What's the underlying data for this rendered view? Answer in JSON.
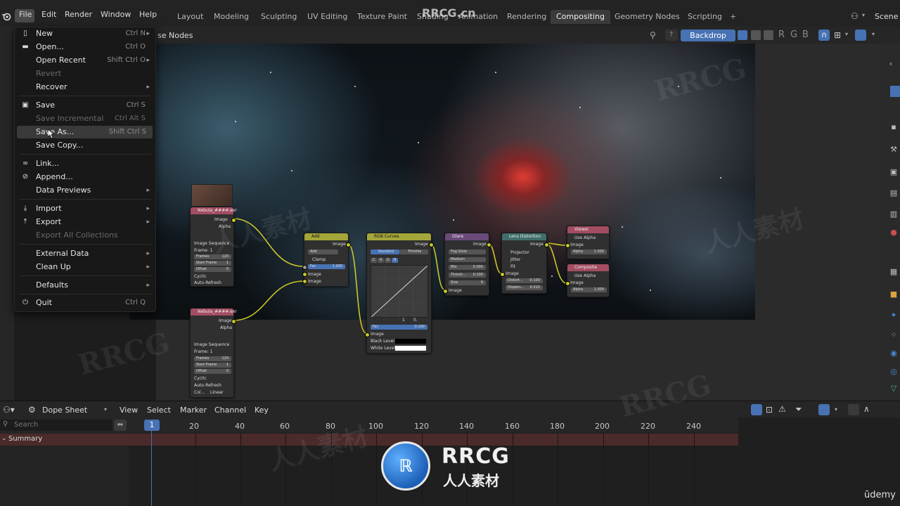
{
  "menubar": [
    "File",
    "Edit",
    "Render",
    "Window",
    "Help"
  ],
  "workspace_tabs": [
    "Layout",
    "Modeling",
    "Sculpting",
    "UV Editing",
    "Texture Paint",
    "Shading",
    "Animation",
    "Rendering",
    "Compositing",
    "Geometry Nodes",
    "Scripting"
  ],
  "active_tab": "Compositing",
  "add_tab_symbol": "+",
  "scene_label": "Scene",
  "watermark_top": "RRCG.cn",
  "node_editor": {
    "use_nodes_label": "se Nodes",
    "partial_label": "e",
    "backdrop_button": "Backdrop",
    "channel_letters": [
      "R",
      "G",
      "B"
    ]
  },
  "file_menu": [
    {
      "label": "New",
      "shortcut": "Ctrl N",
      "arrow": true,
      "icon": "new-file-icon",
      "disabled": false
    },
    {
      "label": "Open...",
      "shortcut": "Ctrl O",
      "icon": "folder-icon",
      "disabled": false
    },
    {
      "label": "Open Recent",
      "shortcut": "Shift Ctrl O",
      "arrow": true,
      "disabled": false
    },
    {
      "label": "Revert",
      "disabled": true
    },
    {
      "label": "Recover",
      "arrow": true,
      "disabled": false
    },
    {
      "label": "Save",
      "shortcut": "Ctrl S",
      "icon": "save-icon",
      "disabled": false
    },
    {
      "label": "Save Incremental",
      "shortcut": "Ctrl Alt S",
      "disabled": true
    },
    {
      "label": "Save As...",
      "shortcut": "Shift Ctrl S",
      "disabled": false,
      "highlight": true
    },
    {
      "label": "Save Copy...",
      "disabled": false
    },
    {
      "label": "Link...",
      "icon": "link-icon",
      "disabled": false
    },
    {
      "label": "Append...",
      "icon": "append-icon",
      "disabled": false
    },
    {
      "label": "Data Previews",
      "arrow": true,
      "disabled": false
    },
    {
      "label": "Import",
      "arrow": true,
      "icon": "import-icon",
      "disabled": false
    },
    {
      "label": "Export",
      "arrow": true,
      "icon": "export-icon",
      "disabled": false
    },
    {
      "label": "Export All Collections",
      "disabled": true
    },
    {
      "label": "External Data",
      "arrow": true,
      "disabled": false
    },
    {
      "label": "Clean Up",
      "arrow": true,
      "disabled": false
    },
    {
      "label": "Defaults",
      "arrow": true,
      "disabled": false
    },
    {
      "label": "Quit",
      "shortcut": "Ctrl Q",
      "icon": "power-icon",
      "disabled": false
    }
  ],
  "nodes": {
    "image1": {
      "title": "Nebula_####.exr",
      "out1": "Image",
      "out2": "Alpha",
      "seq": "Image Sequence",
      "frame": "Frame: 1",
      "frames_l": "Frames",
      "frames_v": "120",
      "start_l": "Start Frame",
      "start_v": "1",
      "offset_l": "Offset",
      "offset_v": "0",
      "cyclic": "Cyclic",
      "auto": "Auto-Refresh"
    },
    "image2": {
      "title": "Nebula_####.exr",
      "out1": "Image",
      "out2": "Alpha",
      "seq": "Image Sequence",
      "frame": "Frame: 1",
      "frames_l": "Frames",
      "frames_v": "120",
      "start_l": "Start Frame",
      "start_v": "1",
      "offset_l": "Offset",
      "offset_v": "0",
      "cyclic": "Cyclic",
      "auto": "Auto-Refresh",
      "col": "Col...",
      "linear": "Linear"
    },
    "add": {
      "title": "Add",
      "out": "Image",
      "mode": "Add",
      "clamp": "Clamp",
      "fac_l": "Fac",
      "fac_v": "1.000",
      "in1": "Image",
      "in2": "Image"
    },
    "rgb": {
      "title": "RGB Curves",
      "out": "Image",
      "tab1": "Standard",
      "tab2": "Filmlike",
      "fac_l": "Fac",
      "fac_v": "0.100",
      "img": "Image",
      "black": "Black Level",
      "white": "White Level",
      "chans": [
        "C",
        "R",
        "G",
        "B"
      ],
      "v1": "1",
      "v2": "0."
    },
    "glare": {
      "title": "Glare",
      "out": "Image",
      "type": "Fog Glow",
      "quality": "Medium",
      "mix_l": "Mix",
      "mix_v": "0.000",
      "thr_l": "Thresh...",
      "thr_v": "0.100",
      "size_l": "Size",
      "size_v": "9",
      "in": "Image"
    },
    "lens": {
      "title": "Lens Distortion",
      "out": "Image",
      "proj": "Projector",
      "jit": "Jitter",
      "fit": "Fit",
      "in": "Image",
      "dist_l": "Distort...",
      "dist_v": "-0.100",
      "disp_l": "Dispers...",
      "disp_v": "0.010"
    },
    "viewer": {
      "title": "Viewer",
      "alpha": "Use Alpha",
      "in1": "Image",
      "in2_l": "Alpha",
      "in2_v": "1.000"
    },
    "composite": {
      "title": "Composite",
      "alpha": "Use Alpha",
      "in1": "Image",
      "in2_l": "Alpha",
      "in2_v": "1.000"
    }
  },
  "dopesheet": {
    "mode": "Dope Sheet",
    "menus": [
      "View",
      "Select",
      "Marker",
      "Channel",
      "Key"
    ],
    "search_placeholder": "Search",
    "summary": "Summary",
    "current_frame": "1",
    "ticks": [
      "20",
      "40",
      "60",
      "80",
      "100",
      "120",
      "140",
      "160",
      "180",
      "200",
      "220",
      "240"
    ]
  },
  "overlay_logo": {
    "title": "RRCG",
    "subtitle": "人人素材"
  },
  "udemy": "ūdemy",
  "watermark_bg": [
    "RRCG",
    "人人素材"
  ]
}
